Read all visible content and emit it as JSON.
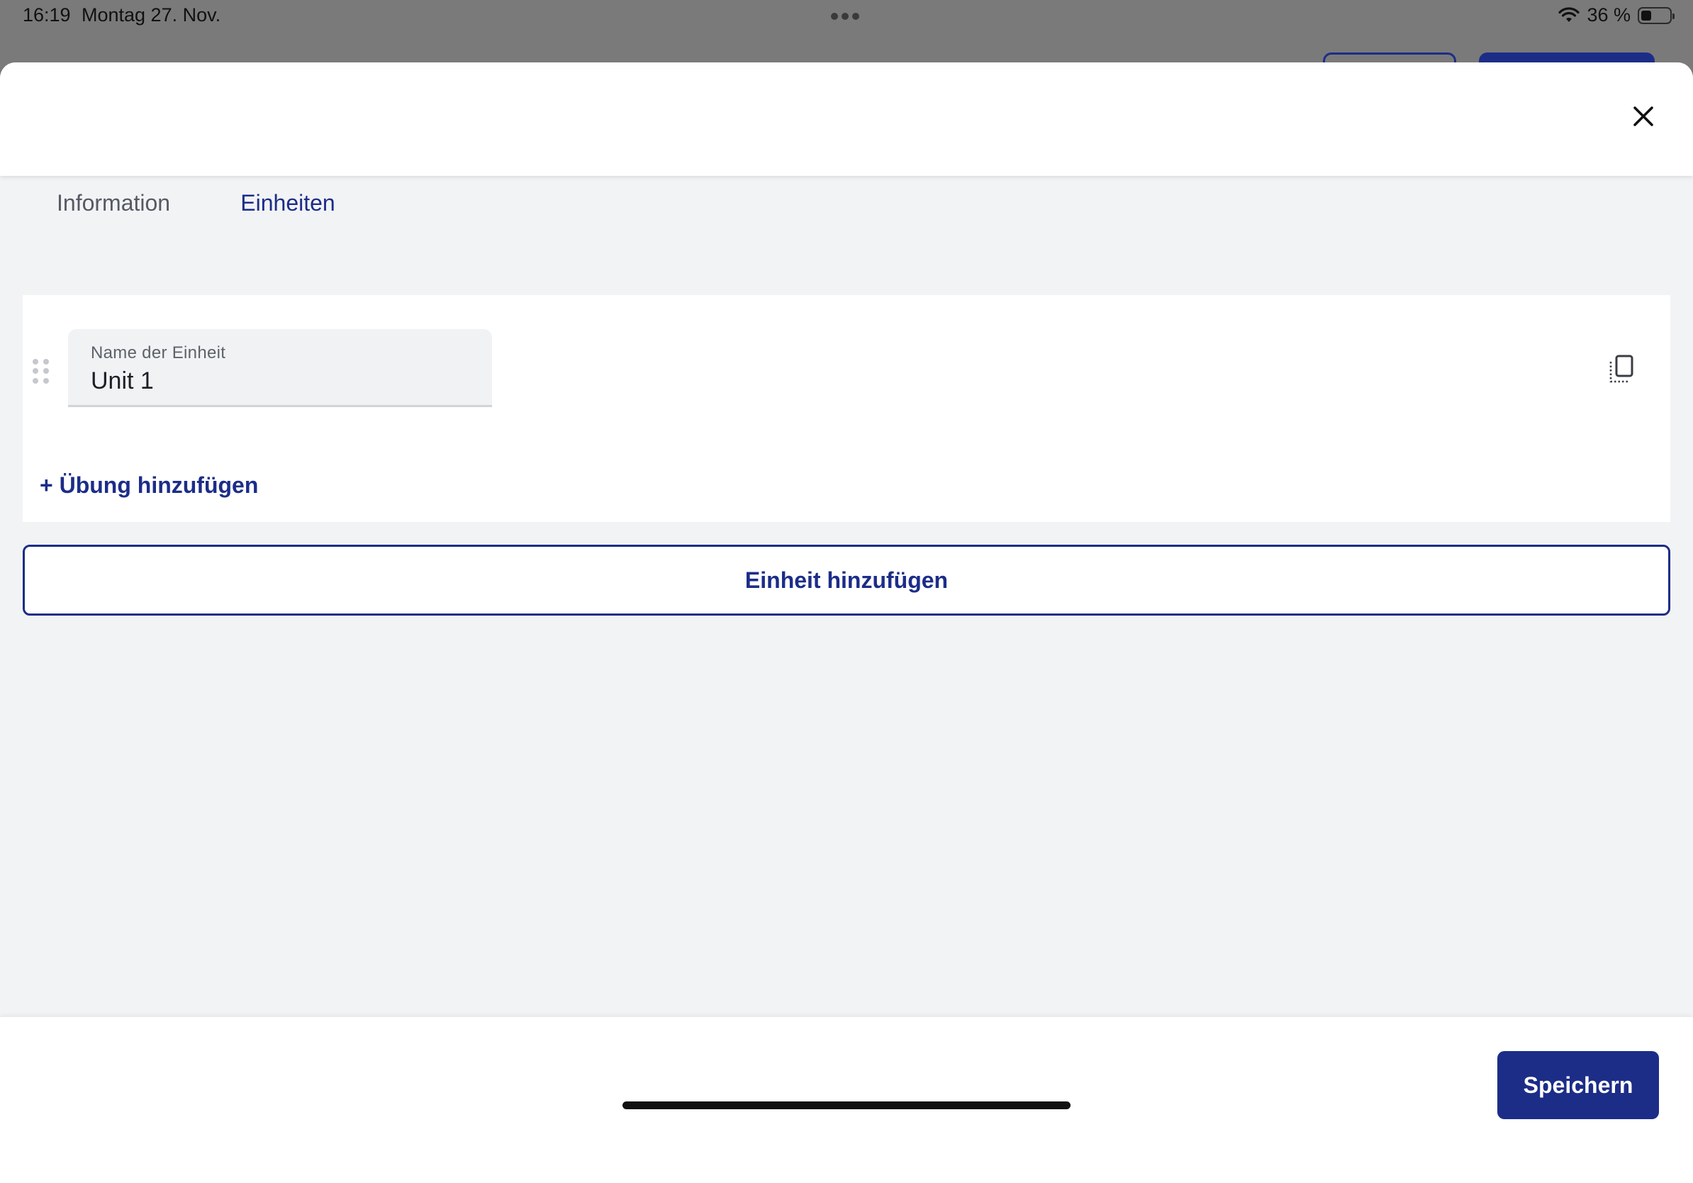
{
  "status_bar": {
    "time": "16:19",
    "date": "Montag 27. Nov.",
    "battery": "36 %",
    "battery_level": 0.36
  },
  "tabs": [
    {
      "label": "Information",
      "active": false
    },
    {
      "label": "Einheiten",
      "active": true
    }
  ],
  "unit": {
    "field_label": "Name der Einheit",
    "field_value": "Unit 1",
    "add_exercise_label": "+ Übung hinzufügen"
  },
  "add_unit_label": "Einheit hinzufügen",
  "save_label": "Speichern",
  "colors": {
    "accent": "#1c2d88",
    "background": "#f2f3f5",
    "tab_inactive": "#555a62"
  }
}
